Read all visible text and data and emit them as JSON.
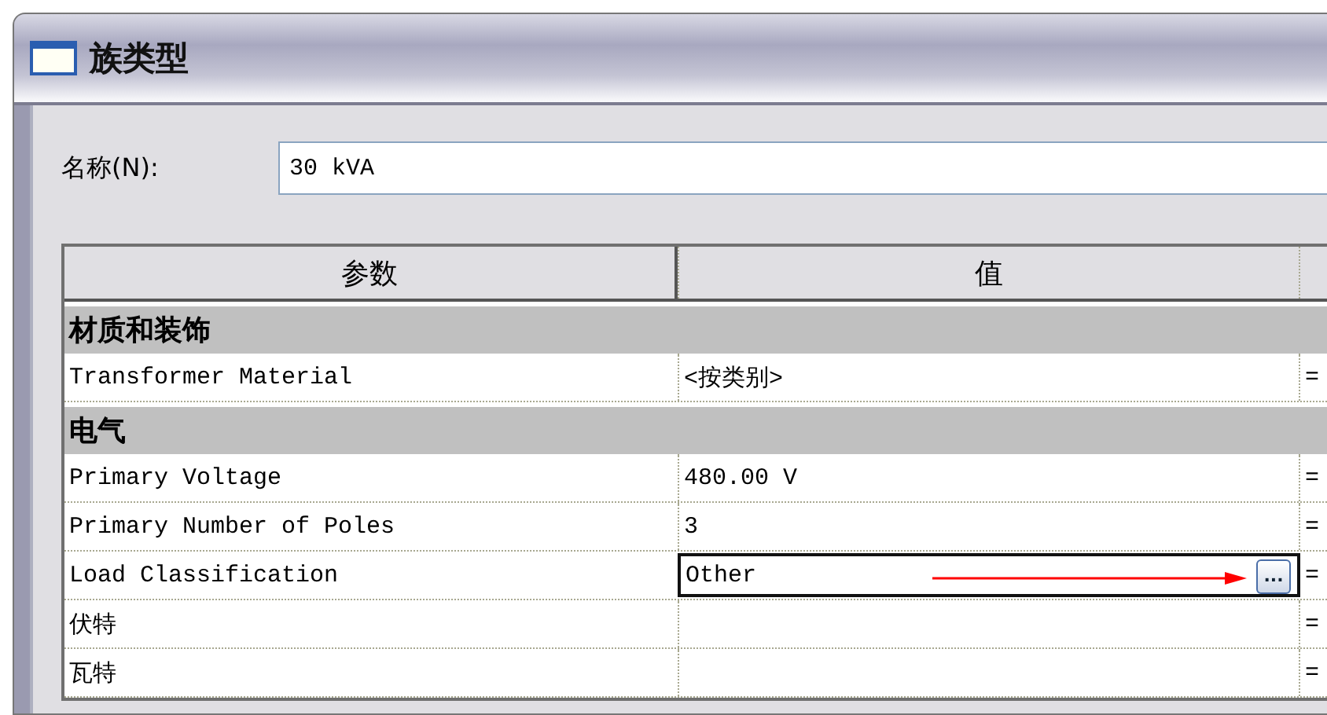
{
  "window": {
    "title": "族类型"
  },
  "name_field": {
    "label": "名称(N):",
    "value": "30 kVA"
  },
  "table": {
    "columns": [
      "参数",
      "值"
    ],
    "groups": [
      {
        "title": "材质和装饰",
        "rows": [
          {
            "parameter": "Transformer Material",
            "value": "<按类别>",
            "column_3": "=",
            "selected": false,
            "arrow": false
          }
        ]
      },
      {
        "title": "电气",
        "rows": [
          {
            "parameter": "Primary Voltage",
            "value": "480.00 V",
            "column_3": "=",
            "selected": false,
            "arrow": false
          },
          {
            "parameter": "Primary Number of Poles",
            "value": "3",
            "column_3": "=",
            "selected": false,
            "arrow": false
          },
          {
            "parameter": "Load Classification",
            "value": "Other",
            "column_3": "=",
            "selected": true,
            "browse_button": "...",
            "arrow": true
          },
          {
            "parameter": "伏特",
            "value": "",
            "column_3": "=",
            "selected": false,
            "arrow": false
          },
          {
            "parameter": "瓦特",
            "value": "",
            "column_3": "=",
            "selected": false,
            "arrow": false
          }
        ]
      }
    ]
  }
}
